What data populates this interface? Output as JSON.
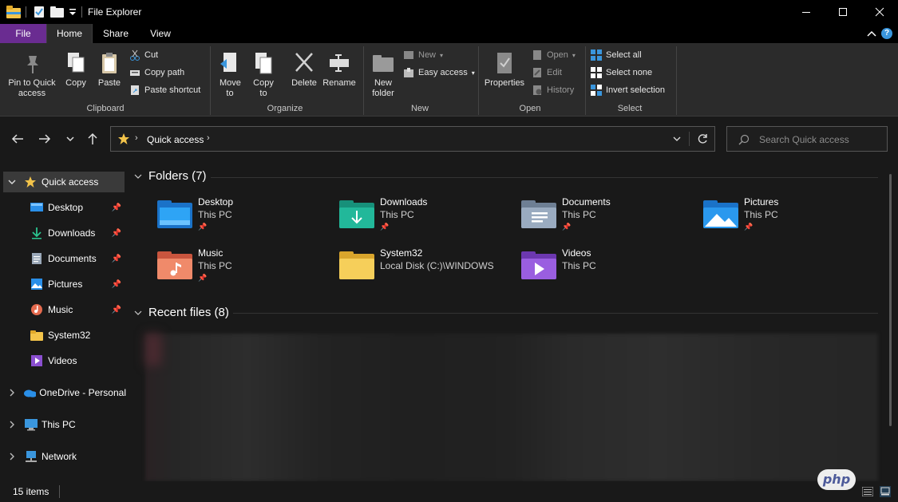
{
  "window": {
    "title": "File Explorer",
    "min_icon": "minimize-icon",
    "max_icon": "maximize-icon",
    "close_icon": "close-icon"
  },
  "tabs": [
    "File",
    "Home",
    "Share",
    "View"
  ],
  "ribbon": {
    "clipboard": {
      "label": "Clipboard",
      "pin": "Pin to Quick access",
      "copy": "Copy",
      "paste": "Paste",
      "cut": "Cut",
      "copy_path": "Copy path",
      "paste_shortcut": "Paste shortcut"
    },
    "organize": {
      "label": "Organize",
      "move_to": "Move to",
      "copy_to": "Copy to",
      "delete": "Delete",
      "rename": "Rename"
    },
    "new": {
      "label": "New",
      "new_folder": "New folder",
      "new_item": "New",
      "easy_access": "Easy access"
    },
    "open": {
      "label": "Open",
      "properties": "Properties",
      "open": "Open",
      "edit": "Edit",
      "history": "History"
    },
    "select": {
      "label": "Select",
      "select_all": "Select all",
      "select_none": "Select none",
      "invert": "Invert selection"
    }
  },
  "address": {
    "path": "Quick access",
    "search_placeholder": "Search Quick access"
  },
  "sidebar": {
    "items": [
      {
        "label": "Quick access",
        "icon": "star-icon"
      },
      {
        "label": "Desktop",
        "icon": "desktop-icon"
      },
      {
        "label": "Downloads",
        "icon": "download-icon"
      },
      {
        "label": "Documents",
        "icon": "documents-icon"
      },
      {
        "label": "Pictures",
        "icon": "pictures-icon"
      },
      {
        "label": "Music",
        "icon": "music-icon"
      },
      {
        "label": "System32",
        "icon": "folder-icon"
      },
      {
        "label": "Videos",
        "icon": "videos-icon"
      },
      {
        "label": "OneDrive - Personal",
        "icon": "onedrive-icon"
      },
      {
        "label": "This PC",
        "icon": "this-pc-icon"
      },
      {
        "label": "Network",
        "icon": "network-icon"
      }
    ]
  },
  "main": {
    "folders_header": "Folders (7)",
    "recent_header": "Recent files (8)",
    "folders": [
      {
        "name": "Desktop",
        "location": "This PC",
        "icon": "desktop-folder-icon",
        "color": "#1e90e8"
      },
      {
        "name": "Downloads",
        "location": "This PC",
        "icon": "downloads-folder-icon",
        "color": "#1aa88a"
      },
      {
        "name": "Documents",
        "location": "This PC",
        "icon": "documents-folder-icon",
        "color": "#8a9bb0"
      },
      {
        "name": "Pictures",
        "location": "This PC",
        "icon": "pictures-folder-icon",
        "color": "#2a8fe8"
      },
      {
        "name": "Music",
        "location": "This PC",
        "icon": "music-folder-icon",
        "color": "#e46a4e"
      },
      {
        "name": "System32",
        "location": "Local Disk (C:)\\WINDOWS",
        "icon": "folder-icon",
        "color": "#f3c44a"
      },
      {
        "name": "Videos",
        "location": "This PC",
        "icon": "videos-folder-icon",
        "color": "#8b4fd0"
      }
    ]
  },
  "status": {
    "items": "15 items"
  },
  "watermark": "php",
  "colors": {
    "file_tab": "#6a2c91",
    "accent": "#3a96dd",
    "background": "#191919"
  }
}
